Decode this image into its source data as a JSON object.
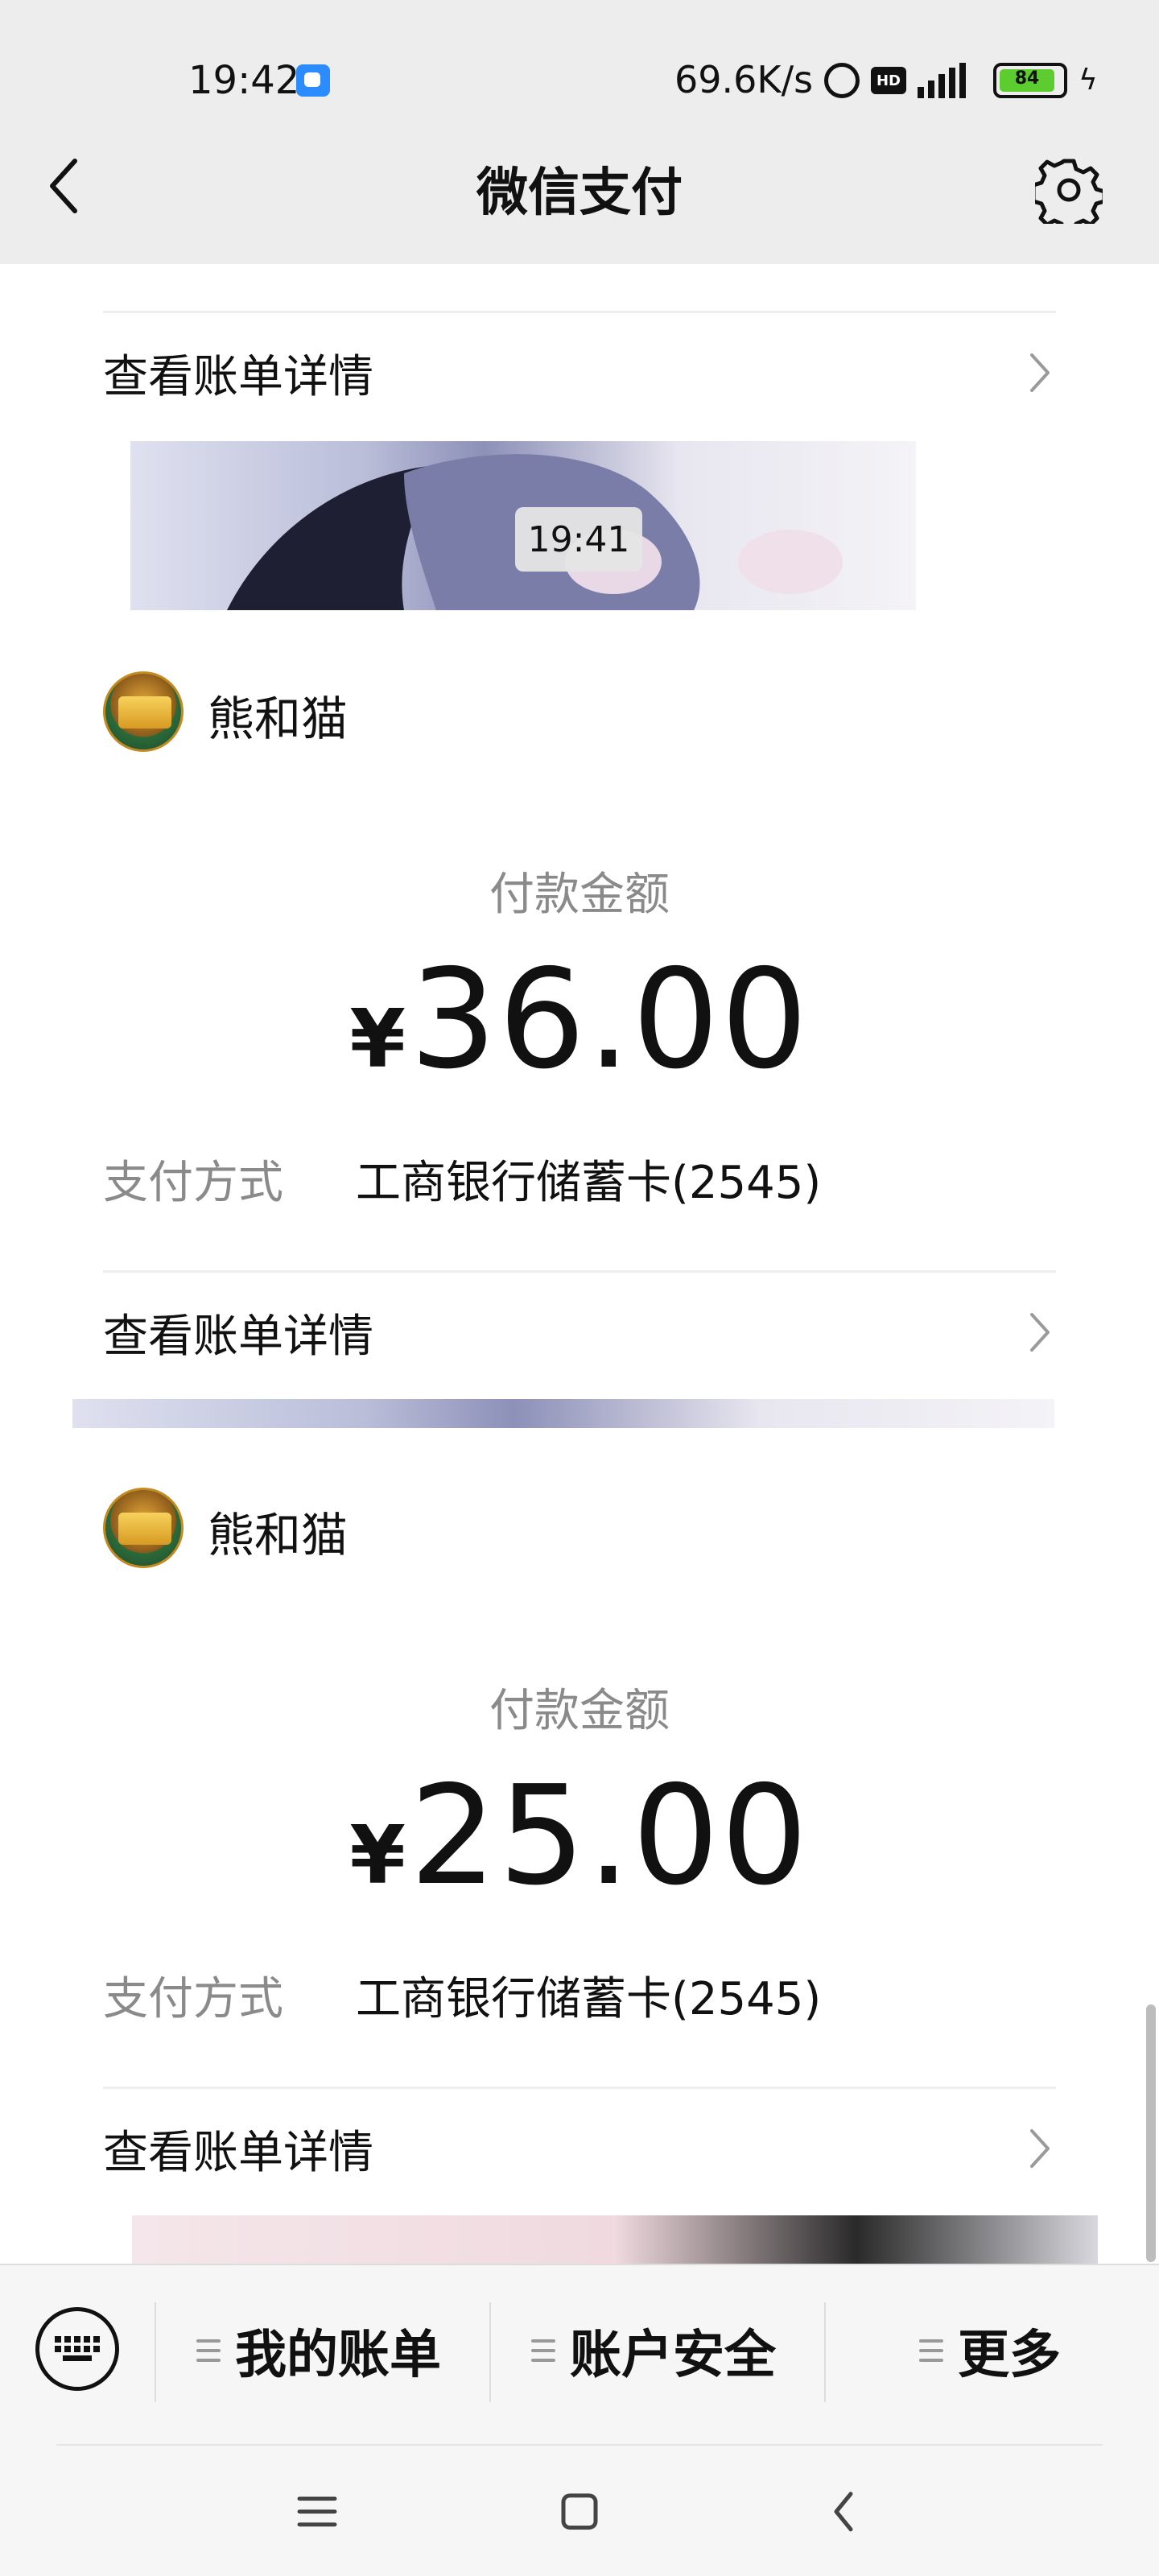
{
  "status_bar": {
    "time": "19:42",
    "net_speed": "69.6K/s",
    "hd_badge": "HD",
    "network": "4G",
    "battery": "84"
  },
  "header": {
    "title": "微信支付"
  },
  "chat": {
    "bill_link_label": "查看账单详情",
    "timestamp": "19:41",
    "cards": [
      {
        "merchant": "熊和猫",
        "amount_label": "付款金额",
        "currency_symbol": "¥",
        "amount": "36.00",
        "method_label": "支付方式",
        "method_value": "工商银行储蓄卡(2545)",
        "link_label": "查看账单详情"
      },
      {
        "merchant": "熊和猫",
        "amount_label": "付款金额",
        "currency_symbol": "¥",
        "amount": "25.00",
        "method_label": "支付方式",
        "method_value": "工商银行储蓄卡(2545)",
        "link_label": "查看账单详情"
      }
    ]
  },
  "bottom_menu": {
    "items": [
      {
        "label": "我的账单"
      },
      {
        "label": "账户安全"
      },
      {
        "label": "更多"
      }
    ]
  },
  "icons": {
    "back": "chevron-left-icon",
    "settings": "gear-icon",
    "keyboard": "keyboard-icon",
    "link_arrow": "chevron-right-icon"
  },
  "colors": {
    "header_bg": "#ededed",
    "battery_fill": "#5ccc2f",
    "secondary_text": "#8a8a8a"
  }
}
